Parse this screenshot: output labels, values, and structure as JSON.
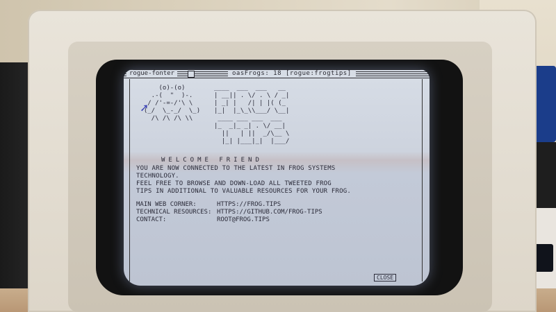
{
  "terminal": {
    "app_name": "rogue-fonter",
    "window_title": "oasFrogs: 18 [rogue:frogtips]",
    "frog_art": "      (o)-(o)\n    .-(  \"  )-.\n   / /'-=-/'\\ \\\n  (_/  \\_-_/  \\_)\n    /\\ /\\ /\\ \\\\",
    "logo_art": "____  ___  ___   __\n| __|| . \\/ . \\ / _|\n| _| |   /| | |( (_\n|_|  |_\\_\\\\___/ \\__|\n ____ ___ ___  ___\n|_  _|_ _| . \\/ __|\n  ||   | ||  _/\\__ \\\n  |_| |___|_|  |___/",
    "welcome": "WELCOME FRIEND",
    "paragraphs": [
      "YOU ARE NOW CONNECTED TO THE LATEST IN FROG SYSTEMS",
      "TECHNOLOGY.",
      "FEEL FREE TO BROWSE AND DOWN-LOAD ALL TWEETED FROG",
      "TIPS IN ADDITIONAL TO VALUABLE RESOURCES FOR YOUR FROG."
    ],
    "links": [
      {
        "label": "MAIN WEB CORNER:",
        "value": "HTTPS://FROG.TIPS"
      },
      {
        "label": "TECHNICAL RESOURCES:",
        "value": "HTTPS://GITHUB.COM/FROG-TIPS"
      },
      {
        "label": "CONTACT:",
        "value": "ROOT@FROG.TIPS"
      }
    ],
    "close_label": "CLOSE"
  },
  "colors": {
    "screen": "#d7dde6",
    "text": "#2a2a38",
    "cursor": "#3d44b5",
    "bezel": "#e9e4da"
  }
}
